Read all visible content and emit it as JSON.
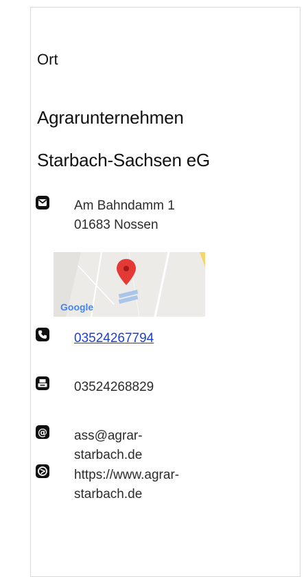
{
  "section_label": "Ort",
  "company": {
    "line1": "Agrarunternehmen",
    "line2": "Starbach-Sachsen eG"
  },
  "address": {
    "icon": "mail-icon",
    "line1": "Am Bahndamm 1",
    "line2": "01683 Nossen"
  },
  "map": {
    "icon": "map-pin-icon",
    "brand": "Google"
  },
  "phone": {
    "icon": "phone-icon",
    "value": "03524267794"
  },
  "fax": {
    "icon": "fax-icon",
    "value": "03524268829"
  },
  "email": {
    "icon": "at-icon",
    "line1": "ass@agrar-",
    "line2": "starbach.de"
  },
  "website": {
    "icon": "globe-icon",
    "line1": "https://www.agrar-",
    "line2": "starbach.de"
  },
  "colors": {
    "link": "#1a3fd1",
    "pin": "#e53935",
    "icon": "#111111"
  }
}
